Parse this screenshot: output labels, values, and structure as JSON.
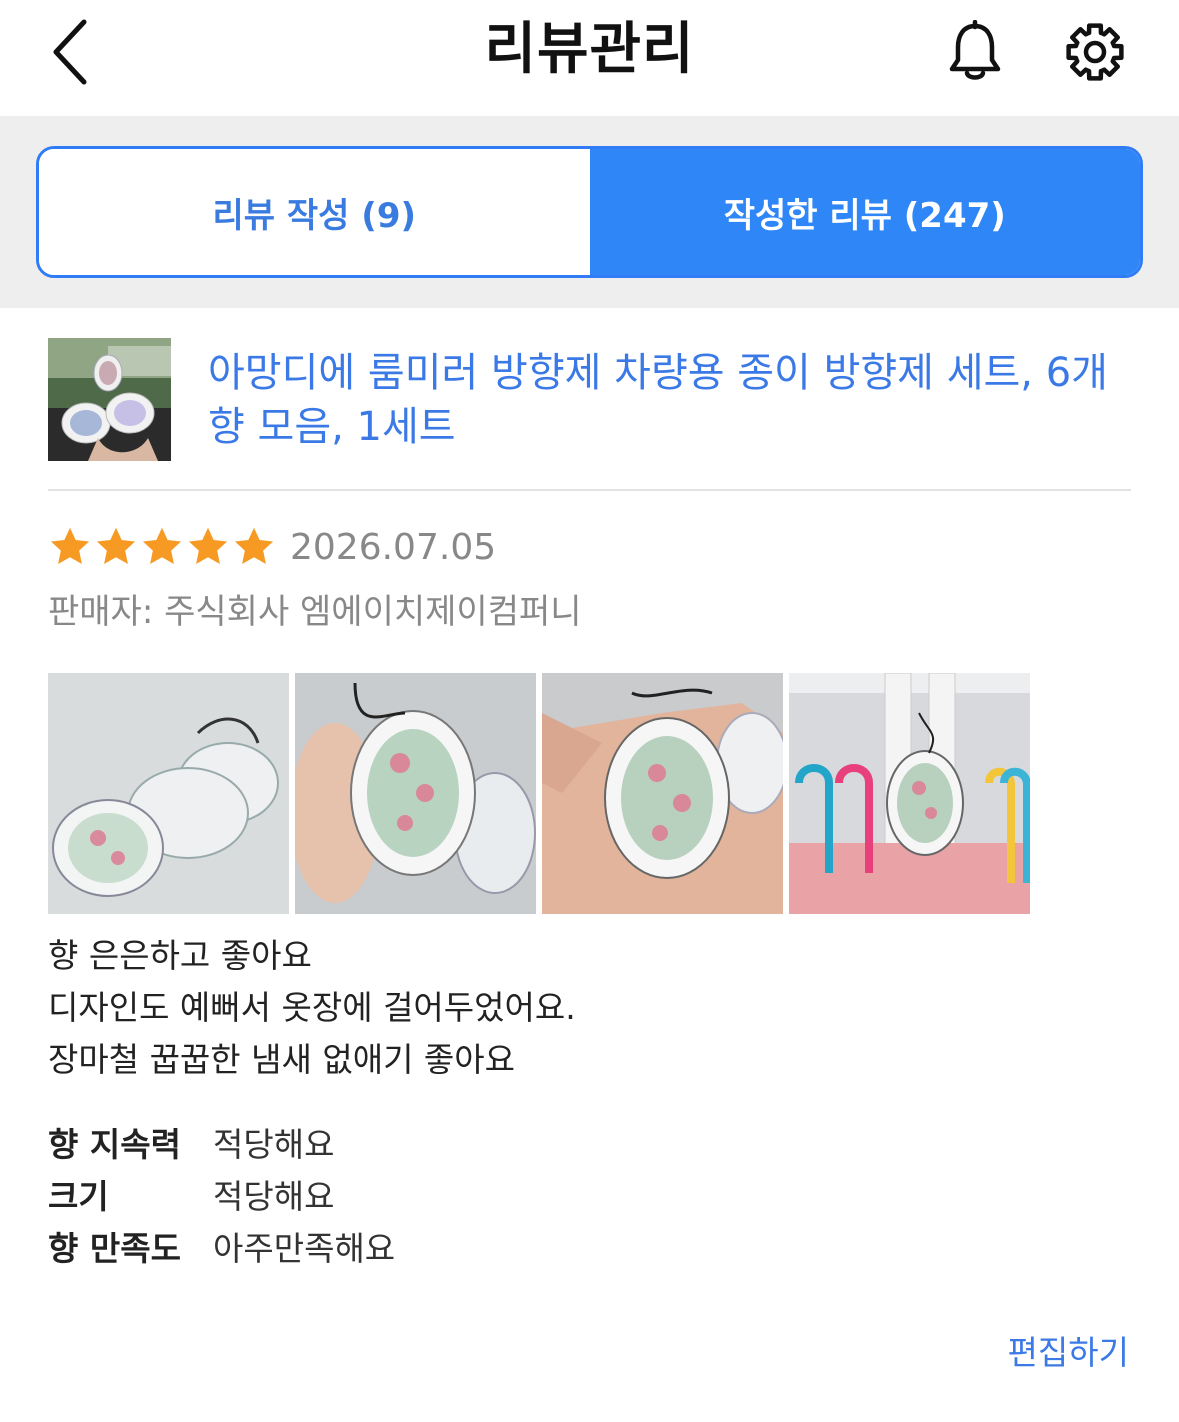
{
  "header": {
    "title": "리뷰관리",
    "icons": {
      "back": "chevron-left-icon",
      "bell": "bell-icon",
      "settings": "gear-icon"
    }
  },
  "tabs": [
    {
      "label": "리뷰 작성 (9)",
      "active": false
    },
    {
      "label": "작성한 리뷰 (247)",
      "active": true
    }
  ],
  "colors": {
    "accent": "#2f86f6",
    "link": "#3b7ae6",
    "star": "#f79a24",
    "muted": "#888888",
    "tab_bg": "#eeeeee"
  },
  "product": {
    "name": "아망디에 룸미러 방향제 차량용 종이 방향제 세트, 6개 향 모음, 1세트"
  },
  "review": {
    "rating": 5,
    "rating_max": 5,
    "date": "2026.07.05",
    "seller": "판매자: 주식회사 엠에이치제이컴퍼니",
    "photo_count": 4,
    "text_lines": [
      "향 은은하고 좋아요",
      "디자인도 예뻐서 옷장에 걸어두었어요.",
      "장마철 꿉꿉한 냄새 없애기 좋아요"
    ],
    "attributes": [
      {
        "label": "향 지속력",
        "value": "적당해요"
      },
      {
        "label": "크기",
        "value": "적당해요"
      },
      {
        "label": "향 만족도",
        "value": "아주만족해요"
      }
    ],
    "edit_label": "편집하기"
  }
}
